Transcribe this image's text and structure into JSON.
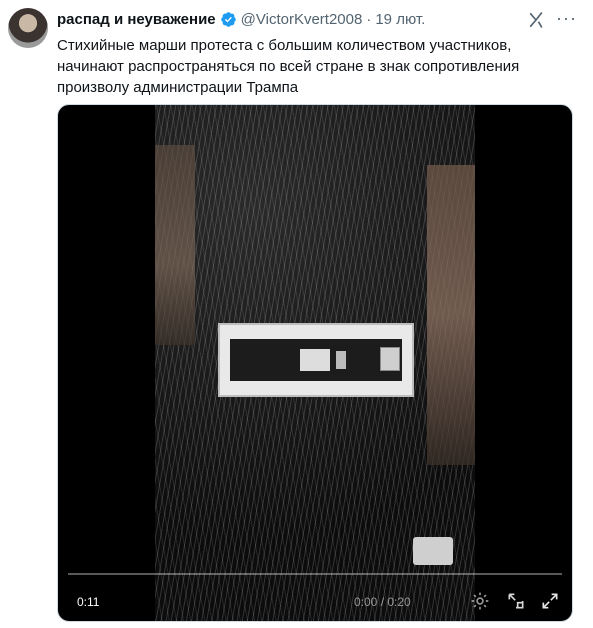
{
  "author": {
    "name": "распад и неуважение",
    "handle": "@VictorKvert2008",
    "separator": "·",
    "date": "19 лют."
  },
  "tweet": {
    "text": "Стихийные марши протеста с большим количеством участников, начинают распространяться по всей стране в знак сопротивления произволу администрации Трампа"
  },
  "video": {
    "elapsed": "0:11",
    "timecode": "0:00 / 0:20",
    "progress_fraction": 0.0
  },
  "icons": {
    "verified": "verified-badge-icon",
    "grok": "grok-icon",
    "more": "more-icon",
    "settings": "settings-icon",
    "pip": "picture-in-picture-icon",
    "fullscreen": "fullscreen-icon"
  },
  "colors": {
    "accent": "#1d9bf0",
    "secondary_text": "#536471"
  }
}
